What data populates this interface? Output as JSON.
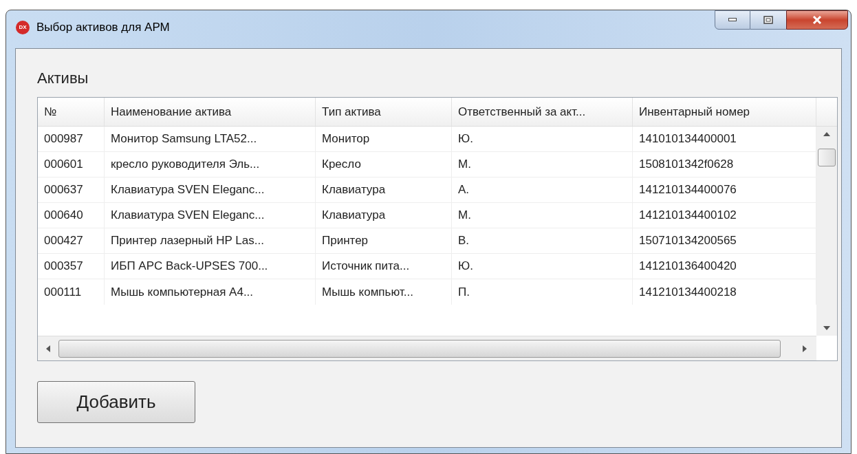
{
  "window": {
    "title": "Выбор активов для АРМ",
    "app_icon_text": "DX"
  },
  "section_label": "Активы",
  "table": {
    "columns": [
      "№",
      "Наименование актива",
      "Тип актива",
      "Ответственный за акт...",
      "Инвентарный номер"
    ],
    "rows": [
      {
        "cells": [
          "000987",
          "Монитор Samsung LTA52...",
          "Монитор",
          "Ю.",
          "141010134400001"
        ]
      },
      {
        "cells": [
          "000601",
          "кресло руководителя Эль...",
          "Кресло",
          "М.",
          "1508101342f0628"
        ]
      },
      {
        "cells": [
          "000637",
          "Клавиатура SVEN Eleganc...",
          "Клавиатура",
          "А.",
          "141210134400076"
        ]
      },
      {
        "cells": [
          "000640",
          "Клавиатура SVEN Eleganc...",
          "Клавиатура",
          "М.",
          "141210134400102"
        ]
      },
      {
        "cells": [
          "000427",
          "Принтер лазерный HP Las...",
          "Принтер",
          "В.",
          "150710134200565"
        ]
      },
      {
        "cells": [
          "000357",
          "ИБП APC Back-UPSES 700...",
          "Источник пита...",
          "Ю.",
          "141210136400420"
        ]
      },
      {
        "cells": [
          "000111",
          "Мышь компьютерная  A4...",
          "Мышь компьют...",
          "П.",
          "141210134400218"
        ]
      }
    ]
  },
  "buttons": [
    "Добавить"
  ]
}
